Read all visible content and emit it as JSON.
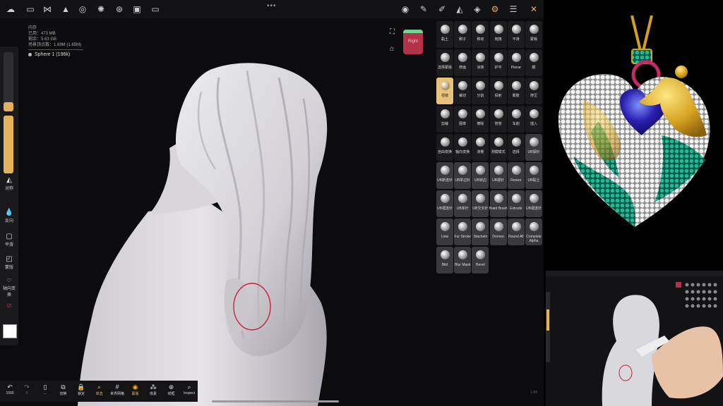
{
  "topbar": {
    "left_icons": [
      "nomad-logo-icon",
      "folder-icon",
      "share-icon",
      "scene-icon",
      "material-icon",
      "light-icon",
      "camera-icon",
      "image-icon",
      "video-icon"
    ],
    "right_icons": [
      "material-ball-icon",
      "brush-icon",
      "paint-icon",
      "symmetry-icon",
      "layers-icon",
      "settings-icon",
      "sliders-icon",
      "tools-icon"
    ],
    "active_icon": "settings-icon"
  },
  "info": {
    "memory_label": "内存",
    "used": "已用：473 MB",
    "free": "剩余：5.63 GB",
    "vertices": "场景顶点数：1.69M (1.65M)",
    "object": "Sphere 1 (196k)"
  },
  "left_panel": {
    "slider1_level": 0.15,
    "slider2_level": 1.0,
    "items": [
      "对称",
      "反向",
      "平滑",
      "蒙版",
      "轴向变换"
    ]
  },
  "view": {
    "cube_label": "Right"
  },
  "tools": {
    "row1": [
      "黏土",
      "刷子",
      "移动",
      "拖拽",
      "平滑",
      "蒙版"
    ],
    "row2": [
      "选择蒙版",
      "修画",
      "涂抹",
      "护平",
      "Planar",
      "膨"
    ],
    "row3": [
      "褶皱",
      "裁切",
      "分割",
      "投射",
      "膨胀",
      "挤压"
    ],
    "row4": [
      "剪裁",
      "图章",
      "擦除",
      "管管",
      "车削",
      "插入"
    ],
    "row5": [
      "自由变换",
      "轴向变换",
      "测量",
      "测摸模式",
      "选择",
      "UB探针"
    ],
    "row6": [
      "UB斯连针",
      "UB单边针",
      "UB锁边",
      "UB褶针",
      "Resize",
      "UB黏土"
    ],
    "row7": [
      "UB褶连针",
      "UB单针",
      "UB交叉针",
      "Braid Brush",
      "Extrude",
      "UB褶连针"
    ],
    "row8": [
      "Linie",
      "Fur Stroke",
      "Stacheln",
      "Dornen",
      "Round All",
      "Complete Alpha"
    ],
    "row9": [
      "Bild",
      "Blur Mask",
      "Bevel"
    ],
    "selected": "褶皱"
  },
  "bottombar": {
    "undo_count": "1000",
    "redo_count": "0",
    "items": [
      "...",
      "切换",
      "锁定",
      "单选",
      "世界网格",
      "蒙版",
      "体素",
      "线框",
      "Inspect"
    ],
    "active": [
      "单选",
      "蒙版"
    ]
  },
  "footer": {
    "version": "1.84"
  },
  "colors": {
    "accent": "#f2b24a",
    "cube": "#b23249",
    "annotation": "#c8233a"
  }
}
